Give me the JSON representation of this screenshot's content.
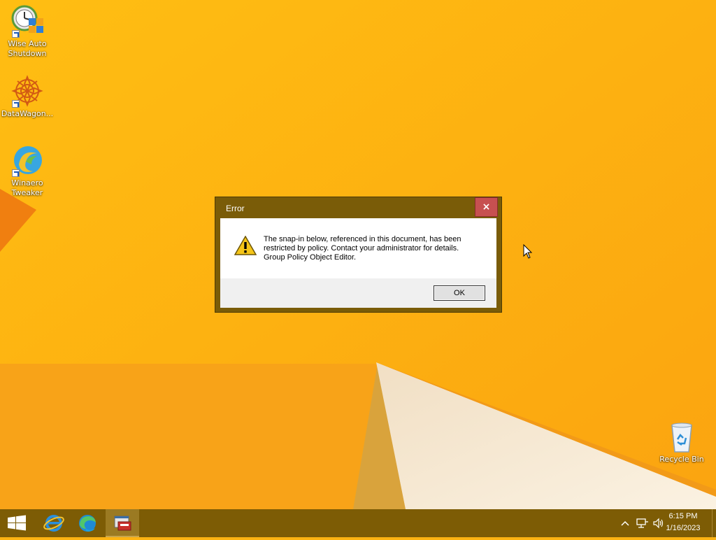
{
  "desktop": {
    "icons": [
      {
        "label_line1": "Wise Auto",
        "label_line2": "Shutdown",
        "icon": "wise-auto-shutdown-icon"
      },
      {
        "label_line1": "DataWagon...",
        "label_line2": "",
        "icon": "datawagon-icon"
      },
      {
        "label_line1": "Winaero",
        "label_line2": "Tweaker",
        "icon": "winaero-tweaker-icon"
      },
      {
        "label_line1": "Recycle Bin",
        "label_line2": "",
        "icon": "recycle-bin-icon"
      }
    ]
  },
  "dialog": {
    "title": "Error",
    "close_label": "×",
    "message_lines": [
      "The snap-in below, referenced in this document, has been",
      "restricted by policy. Contact your administrator for details.",
      "Group Policy Object Editor."
    ],
    "ok_label": "OK",
    "icon": "warning-icon"
  },
  "taskbar": {
    "items": [
      "start-button",
      "internet-explorer-icon",
      "edge-icon",
      "mmc-icon"
    ],
    "tray": {
      "time": "6:15 PM",
      "date": "1/16/2023"
    }
  },
  "colors": {
    "wallpaper": "#fdb312",
    "taskbar": "#7d5c05",
    "dialog_frame": "#7a5c08",
    "close_button": "#c75050"
  }
}
